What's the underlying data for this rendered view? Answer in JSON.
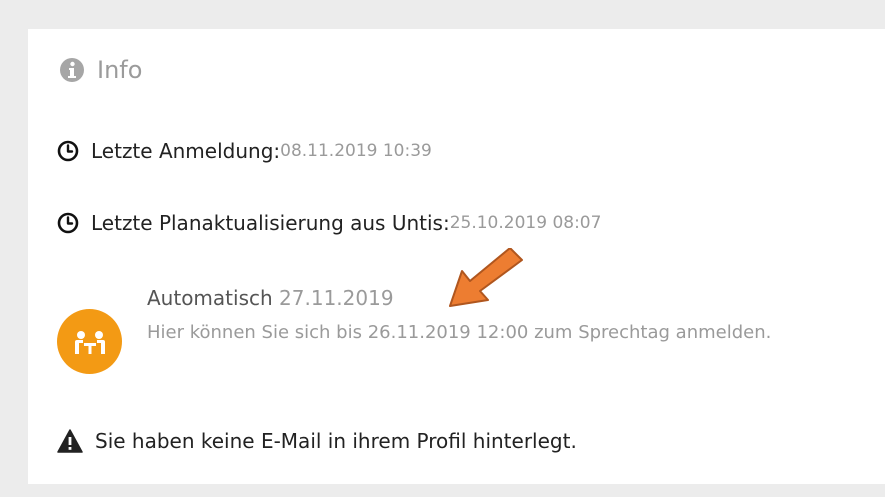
{
  "header": {
    "title": "Info",
    "icon": "info-circle-icon"
  },
  "last_login": {
    "label": "Letzte Anmeldung:",
    "value": "08.11.2019 10:39",
    "icon": "clock-icon"
  },
  "last_plan_update": {
    "label": "Letzte Planaktualisierung aus Untis:",
    "value": "25.10.2019 08:07",
    "icon": "clock-icon"
  },
  "event": {
    "title": "Automatisch",
    "date": "27.11.2019",
    "description": "Hier können Sie sich bis 26.11.2019 12:00 zum Sprechtag anmelden.",
    "icon": "meeting-icon",
    "icon_color": "#f39a14"
  },
  "warning": {
    "text": "Sie haben keine E-Mail in ihrem Profil hinterlegt.",
    "icon": "warning-icon"
  },
  "annotation": {
    "arrow_color": "#ed7d31"
  }
}
